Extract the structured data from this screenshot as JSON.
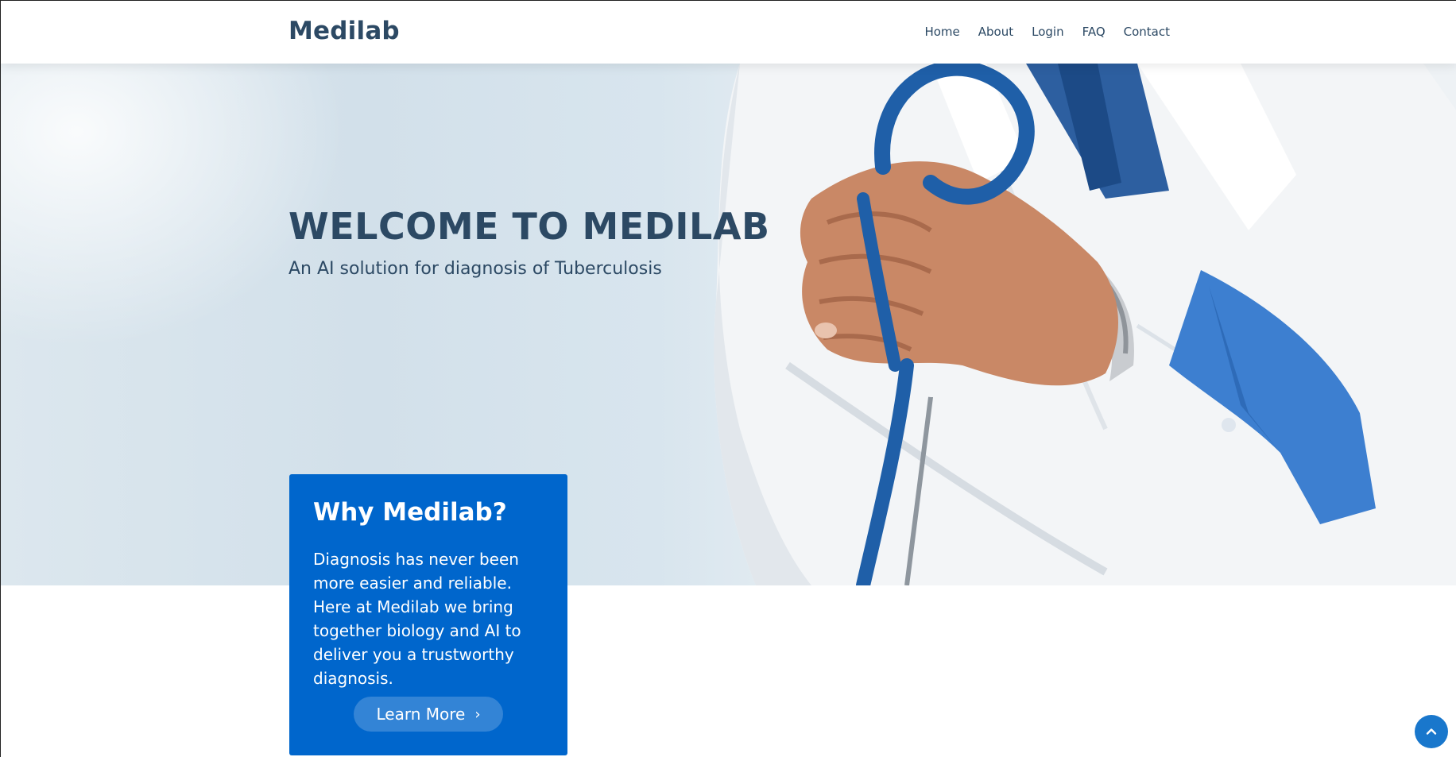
{
  "brand": {
    "logo_text": "Medilab"
  },
  "nav": {
    "items": [
      {
        "label": "Home"
      },
      {
        "label": "About"
      },
      {
        "label": "Login"
      },
      {
        "label": "FAQ"
      },
      {
        "label": "Contact"
      }
    ]
  },
  "hero": {
    "title": "WELCOME TO MEDILAB",
    "subtitle": "An AI solution for diagnosis of Tuberculosis"
  },
  "why_box": {
    "title": "Why Medilab?",
    "body": "Diagnosis has never been more easier and reliable. Here at Medilab we bring together biology and AI to deliver you a trustworthy diagnosis.",
    "button_label": "Learn More",
    "button_icon": "chevron-right-icon"
  },
  "back_to_top": {
    "icon": "chevron-up-icon"
  },
  "colors": {
    "primary": "#1977cc",
    "box_blue": "#0066cc",
    "heading": "#2c4964",
    "hero_bg": "#dce7ee"
  }
}
